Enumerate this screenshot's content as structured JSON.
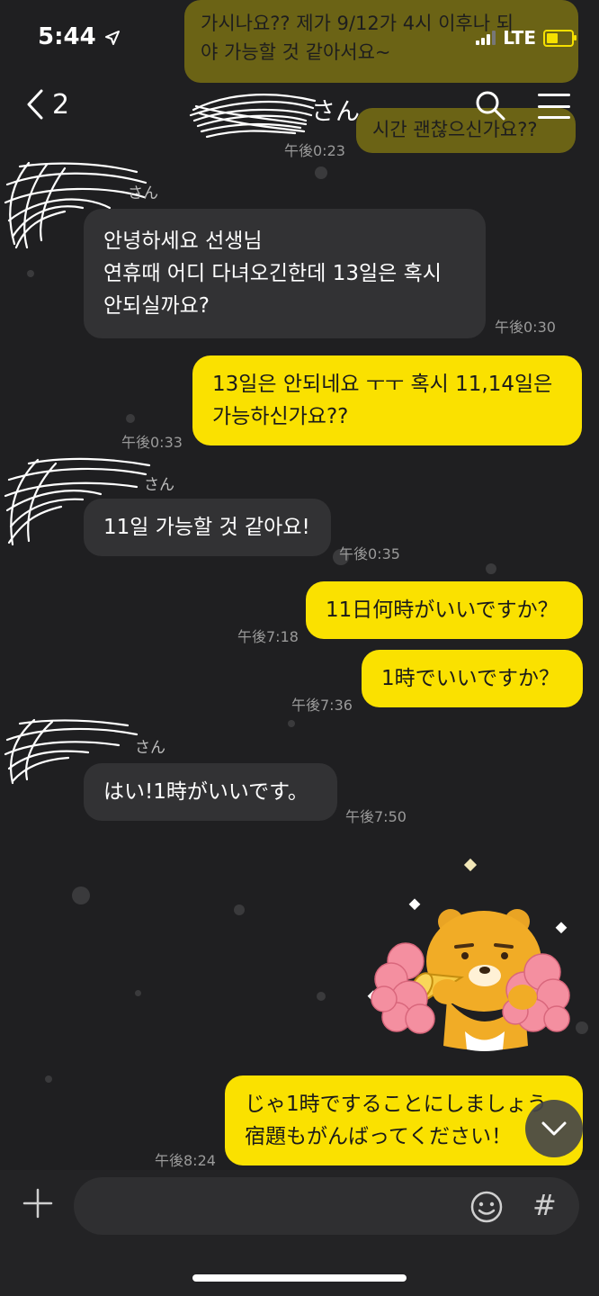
{
  "status_bar": {
    "time": "5:44",
    "network": "LTE"
  },
  "header": {
    "back_count": "2",
    "title": "さん"
  },
  "top_faded_bubble": {
    "line1": "가시나요?? 제가 9/12가 4시 이후나 되",
    "line2": "야 가능할 것 같아서요~",
    "line3": "시간 괜찮으신가요??",
    "time": "午後0:23"
  },
  "messages": [
    {
      "sender": "さん",
      "lines": [
        "안녕하세요 선생님",
        "연휴때 어디 다녀오긴한데 13일은 혹시",
        "안되실까요?"
      ],
      "time": "午後0:30"
    },
    {
      "lines": [
        "13일은 안되네요 ㅜㅜ 혹시 11,14일은",
        "가능하신가요??"
      ],
      "time": "午後0:33"
    },
    {
      "sender": "さん",
      "lines": [
        "11일 가능할 것 같아요!"
      ],
      "time": "午後0:35"
    },
    {
      "lines": [
        "11日何時がいいですか？"
      ],
      "time": "午後7:18"
    },
    {
      "lines": [
        "1時でいいですか？"
      ],
      "time": "午後7:36"
    },
    {
      "sender": "さん",
      "lines": [
        "はい!1時がいいです。"
      ],
      "time": "午後7:50"
    },
    {
      "lines": [
        "じゃ1時ですることにしましょう",
        "宿題もがんばってください！"
      ],
      "time": "午後8:24"
    }
  ],
  "input": {
    "placeholder": ""
  },
  "colors": {
    "background": "#1f1f21",
    "bubble_out": "#fae100",
    "bubble_in": "#323234"
  },
  "icons": [
    "back-chevron-icon",
    "search-icon",
    "menu-icon",
    "plus-icon",
    "emoji-icon",
    "hash-icon",
    "chevron-down-icon",
    "ryan-sticker"
  ]
}
